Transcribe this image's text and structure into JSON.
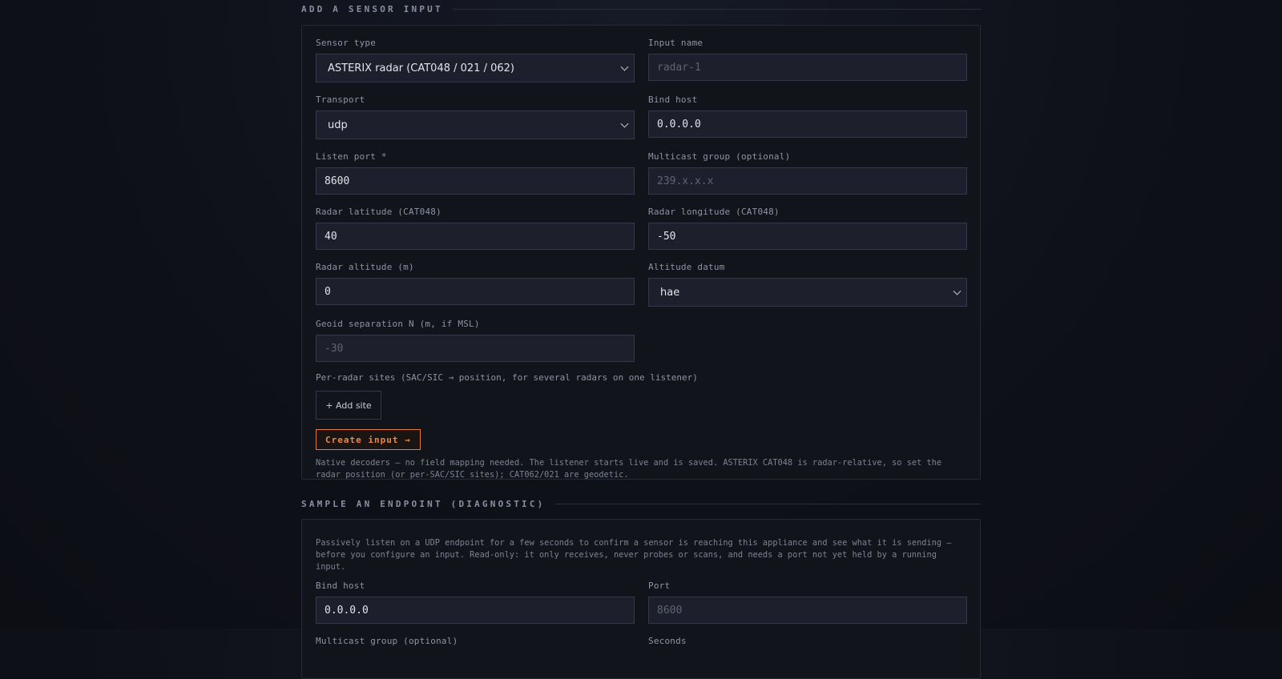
{
  "add_section": {
    "title": "ADD A SENSOR INPUT",
    "sensor_type": {
      "label": "Sensor type",
      "value": "ASTERIX radar (CAT048 / 021 / 062)"
    },
    "input_name": {
      "label": "Input name",
      "placeholder": "radar-1"
    },
    "transport": {
      "label": "Transport",
      "value": "udp"
    },
    "bind_host": {
      "label": "Bind host",
      "value": "0.0.0.0"
    },
    "listen_port": {
      "label": "Listen port *",
      "value": "8600"
    },
    "multicast": {
      "label": "Multicast group (optional)",
      "placeholder": "239.x.x.x"
    },
    "radar_lat": {
      "label": "Radar latitude (CAT048)",
      "value": "40"
    },
    "radar_lon": {
      "label": "Radar longitude (CAT048)",
      "value": "-50"
    },
    "radar_alt": {
      "label": "Radar altitude (m)",
      "value": "0"
    },
    "alt_datum": {
      "label": "Altitude datum",
      "value": "hae"
    },
    "geoid": {
      "label": "Geoid separation N (m, if MSL)",
      "placeholder": "-30"
    },
    "sites_label": "Per-radar sites (SAC/SIC → position, for several radars on one listener)",
    "add_site_label": "+ Add site",
    "create_label": "Create input →",
    "note": "Native decoders — no field mapping needed. The listener starts live and is saved. ASTERIX CAT048 is radar-relative, so set the radar position (or per-SAC/SIC sites); CAT062/021 are geodetic."
  },
  "sample_section": {
    "title": "SAMPLE AN ENDPOINT (DIAGNOSTIC)",
    "description": "Passively listen on a UDP endpoint for a few seconds to confirm a sensor is reaching this appliance and see what it is sending — before you configure an input. Read-only: it only receives, never probes or scans, and needs a port not yet held by a running input.",
    "bind_host": {
      "label": "Bind host",
      "value": "0.0.0.0"
    },
    "port": {
      "label": "Port",
      "placeholder": "8600"
    },
    "multicast_label": "Multicast group (optional)",
    "seconds_label": "Seconds"
  },
  "colors": {
    "accent": "#e07a3a",
    "background": "#0f1119",
    "panel": "#12141c"
  }
}
